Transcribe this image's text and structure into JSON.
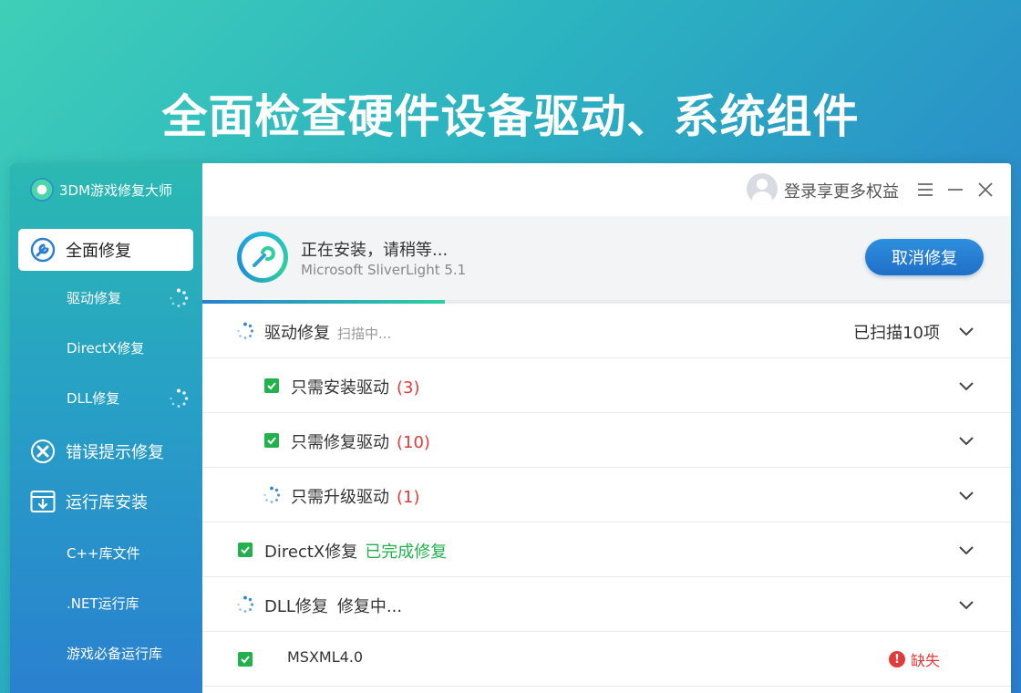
{
  "banner": {
    "title": "全面检查硬件设备驱动、系统组件"
  },
  "app": {
    "name": "3DM游戏修复大师"
  },
  "sidebar": {
    "items": [
      {
        "label": "全面修复",
        "icon": "wrench-icon",
        "active": true
      },
      {
        "label": "驱动修复",
        "sub": true,
        "loading": true
      },
      {
        "label": "DirectX修复",
        "sub": true
      },
      {
        "label": "DLL修复",
        "sub": true,
        "loading": true
      },
      {
        "label": "错误提示修复",
        "icon": "error-x-icon"
      },
      {
        "label": "运行库安装",
        "icon": "download-box-icon"
      },
      {
        "label": "C++库文件",
        "sub": true
      },
      {
        "label": ".NET运行库",
        "sub": true
      },
      {
        "label": "游戏必备运行库",
        "sub": true
      }
    ]
  },
  "topbar": {
    "login_text": "登录享更多权益",
    "icons": [
      "menu-icon",
      "minimize-icon",
      "close-icon"
    ]
  },
  "install": {
    "title": "正在安装，请稍等...",
    "subtitle": "Microsoft SliverLight 5.1",
    "cancel_label": "取消修复",
    "progress": 0.3
  },
  "rows": [
    {
      "label": "驱动修复",
      "status": "扫描中...",
      "status_style": "gray",
      "right_text": "已扫描10项",
      "indicator": "spinner"
    },
    {
      "label": "只需安装驱动",
      "count": "(3)",
      "indicator": "checkbox",
      "indent": true
    },
    {
      "label": "只需修复驱动",
      "count": "(10)",
      "indicator": "checkbox",
      "indent": true
    },
    {
      "label": "只需升级驱动",
      "count": "(1)",
      "indicator": "spinner",
      "indent": true
    },
    {
      "label": "DirectX修复",
      "status": "已完成修复",
      "status_style": "green",
      "indicator": "checkbox"
    },
    {
      "label": "DLL修复",
      "status": "修复中...",
      "status_style": "dark",
      "indicator": "spinner"
    },
    {
      "label": "MSXML4.0",
      "indicator": "checkbox",
      "missing": "缺失"
    }
  ],
  "colors": {
    "accent": "#2a7fd0",
    "green": "#22b14c",
    "red": "#e23a3a"
  }
}
